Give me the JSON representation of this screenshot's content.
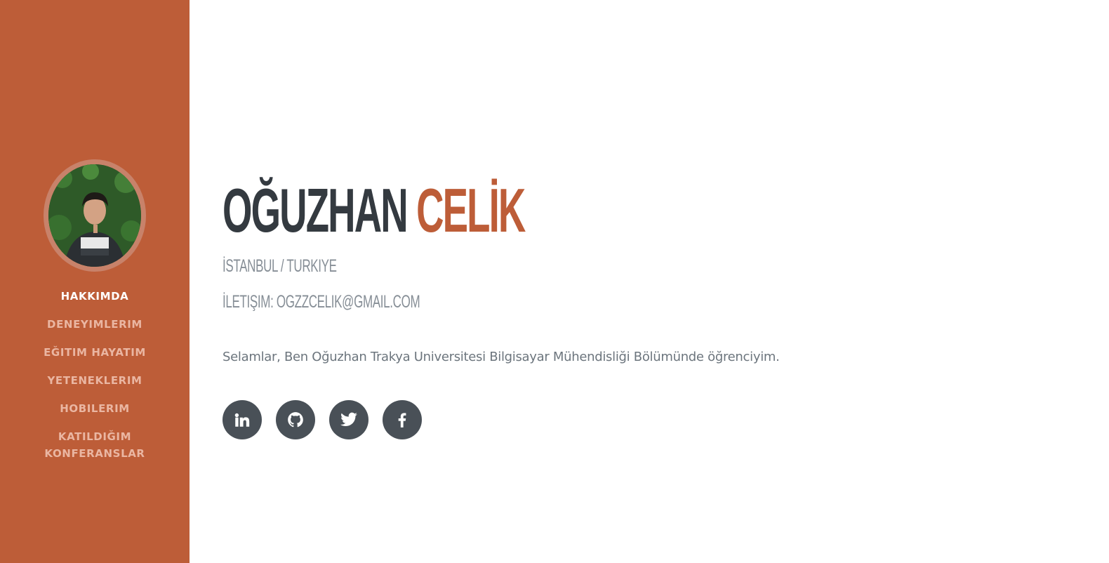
{
  "sidebar": {
    "background": "#bd5d38",
    "nav_items": [
      {
        "label": "HAKKIMDA",
        "active": true
      },
      {
        "label": "DENEYIMLERIM",
        "active": false
      },
      {
        "label": "EĞITIM HAYATIM",
        "active": false
      },
      {
        "label": "YETENEKLERIM",
        "active": false
      },
      {
        "label": "HOBILERIM",
        "active": false
      },
      {
        "label": "KATILDIĞIM KONFERANSLAR",
        "active": false
      }
    ]
  },
  "profile": {
    "first_name": "OĞUZHAN",
    "last_name": "CELİK",
    "location": "İSTANBUL / TURKIYE",
    "contact": "İLETIŞIM: OGZZCELIK@GMAIL.COM",
    "bio": "Selamlar, Ben Oğuzhan Trakya Universitesi Bilgisayar Mühendisliği Bölümünde öğrenciyim."
  },
  "socials": [
    {
      "icon": "linkedin-icon"
    },
    {
      "icon": "github-icon"
    },
    {
      "icon": "twitter-icon"
    },
    {
      "icon": "facebook-icon"
    }
  ],
  "colors": {
    "accent": "#bd5d38",
    "heading": "#343a40",
    "muted": "#868e96",
    "social_bg": "#495057"
  }
}
